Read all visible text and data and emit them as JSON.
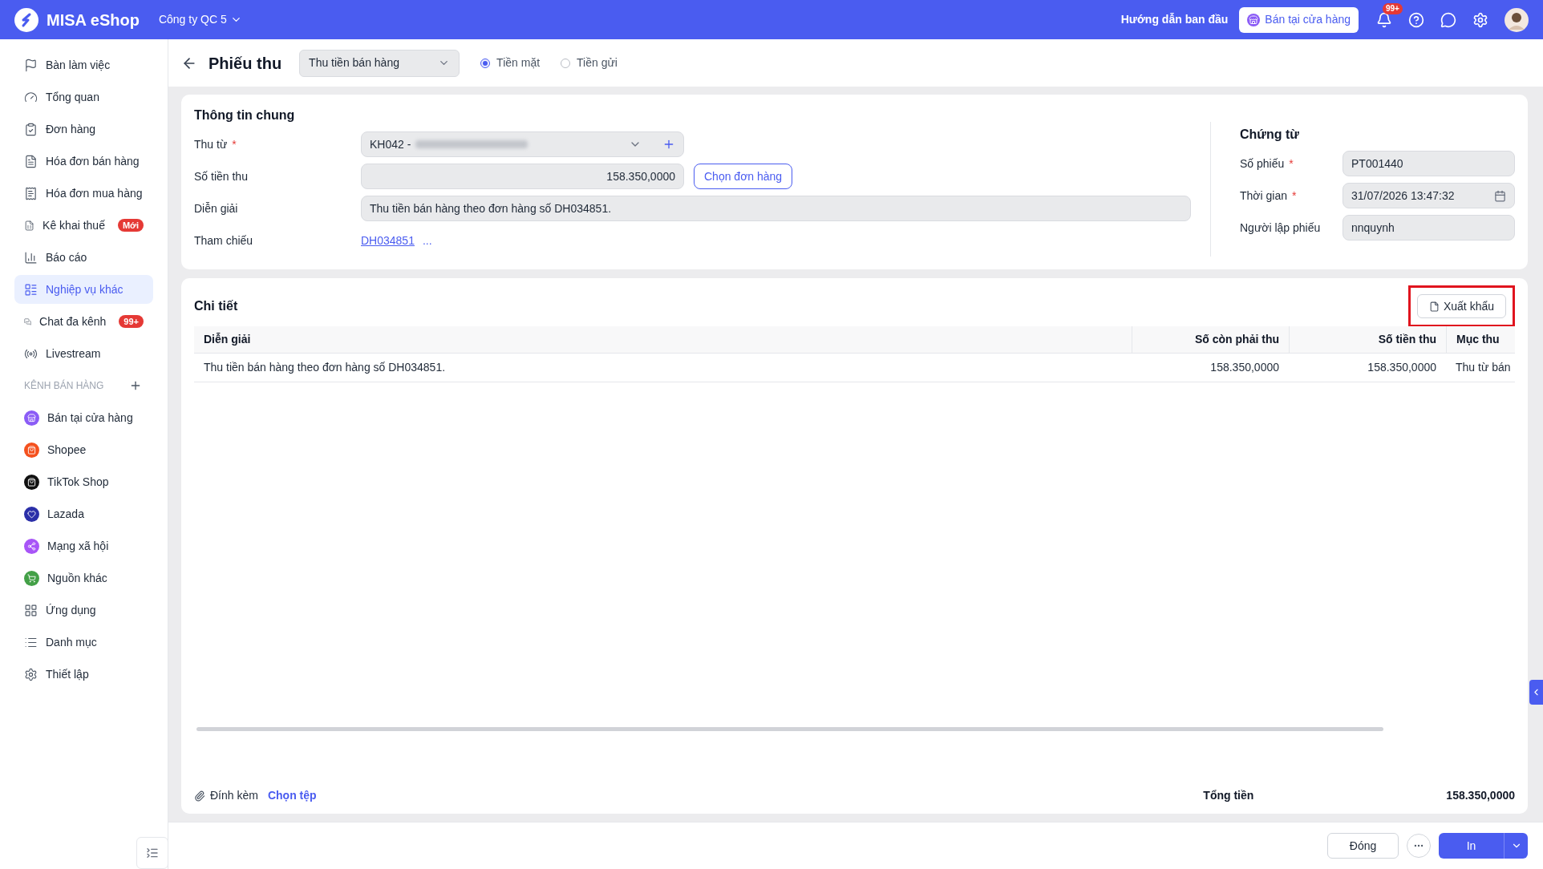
{
  "topbar": {
    "brand": "MISA eShop",
    "company": "Công ty QC 5",
    "guide": "Hướng dẫn ban đầu",
    "store_button": "Bán tại cửa hàng",
    "notification_badge": "99+"
  },
  "sidebar": {
    "items": [
      {
        "label": "Bàn làm việc",
        "selected": false
      },
      {
        "label": "Tổng quan",
        "selected": false
      },
      {
        "label": "Đơn hàng",
        "selected": false
      },
      {
        "label": "Hóa đơn bán hàng",
        "selected": false
      },
      {
        "label": "Hóa đơn mua hàng",
        "selected": false
      },
      {
        "label": "Kê khai thuế",
        "selected": false,
        "badge": "Mới"
      },
      {
        "label": "Báo cáo",
        "selected": false
      },
      {
        "label": "Nghiệp vụ khác",
        "selected": true
      },
      {
        "label": "Chat đa kênh",
        "selected": false,
        "badge": "99+"
      },
      {
        "label": "Livestream",
        "selected": false
      }
    ],
    "section_title": "KÊNH BÁN HÀNG",
    "channels": [
      {
        "label": "Bán tại cửa hàng",
        "color": "#8b5cf6"
      },
      {
        "label": "Shopee",
        "color": "#f4511e"
      },
      {
        "label": "TikTok Shop",
        "color": "#111111"
      },
      {
        "label": "Lazada",
        "color": "#2b2fa8"
      },
      {
        "label": "Mạng xã hội",
        "color": "#a855f7"
      },
      {
        "label": "Nguồn khác",
        "color": "#43a047"
      }
    ],
    "bottom_items": [
      {
        "label": "Ứng dụng",
        "selected": false
      },
      {
        "label": "Danh mục",
        "selected": false
      },
      {
        "label": "Thiết lập",
        "selected": false
      }
    ]
  },
  "header": {
    "title": "Phiếu thu",
    "type_select": "Thu tiền bán hàng",
    "payment_options": [
      {
        "label": "Tiền mặt",
        "selected": true
      },
      {
        "label": "Tiền gửi",
        "selected": false
      }
    ]
  },
  "general": {
    "title": "Thông tin chung",
    "fields": [
      {
        "kind": "select",
        "label": "Thu từ",
        "required_mark": "*",
        "value": "KH042 -"
      },
      {
        "kind": "amount",
        "label": "Số tiền thu",
        "value": "158.350,0000",
        "action": "Chọn đơn hàng"
      },
      {
        "kind": "text",
        "label": "Diễn giải",
        "value": "Thu tiền bán hàng theo đơn hàng số DH034851."
      },
      {
        "kind": "link",
        "label": "Tham chiếu",
        "value": "DH034851",
        "more": "..."
      }
    ]
  },
  "voucher": {
    "title": "Chứng từ",
    "fields": [
      {
        "kind": "text",
        "label": "Số phiếu",
        "required_mark": "*",
        "value": "PT001440"
      },
      {
        "kind": "date",
        "label": "Thời gian",
        "required_mark": "*",
        "value": "31/07/2026 13:47:32"
      },
      {
        "kind": "text",
        "label": "Người lập phiếu",
        "value": "nnquynh"
      }
    ]
  },
  "detail": {
    "title": "Chi tiết",
    "export_button": "Xuất khẩu",
    "export_highlighted": true,
    "table": {
      "columns": [
        "Diễn giải",
        "Số còn phải thu",
        "Số tiền thu",
        "Mục thu"
      ],
      "rows": [
        [
          "Thu tiền bán hàng theo đơn hàng số DH034851.",
          "158.350,0000",
          "158.350,0000",
          "Thu từ bán"
        ]
      ]
    },
    "attach_label": "Đính kèm",
    "attach_link": "Chọn tệp",
    "total_label": "Tổng tiền",
    "total_value": "158.350,0000"
  },
  "footer": {
    "close_button": "Đóng",
    "print_button": "In"
  }
}
